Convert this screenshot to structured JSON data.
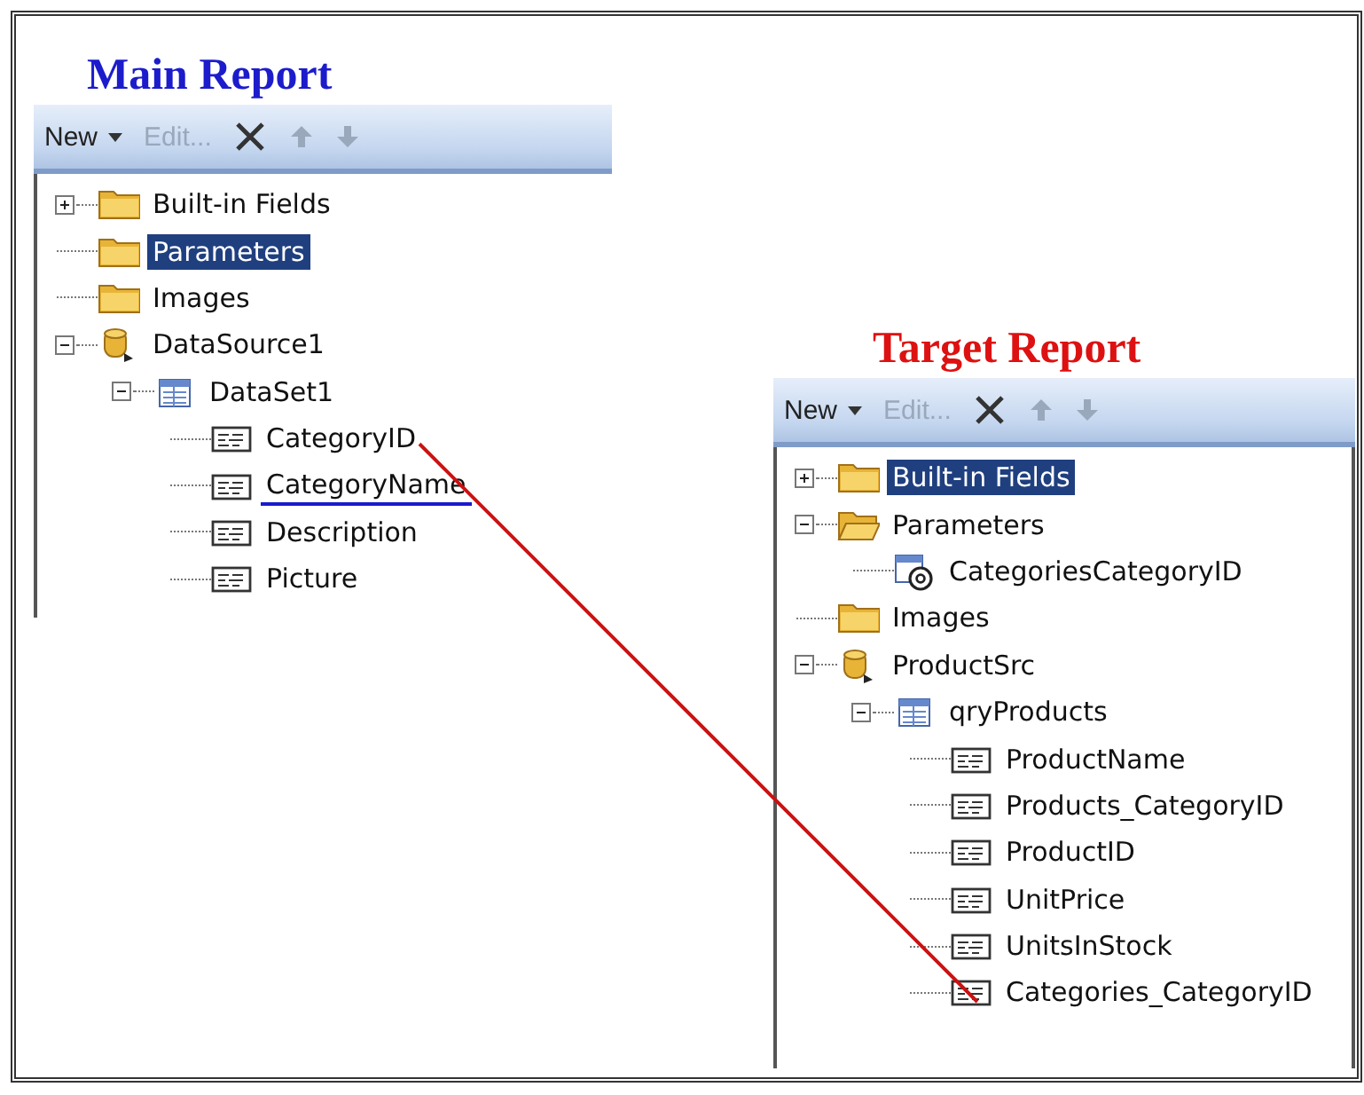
{
  "panels": [
    {
      "title": "Main Report",
      "color": "#1c1ccc",
      "kind": "main",
      "toolbar": [
        {
          "kind": "menu",
          "label": "New",
          "disabled": false
        },
        {
          "kind": "text",
          "label": "Edit...",
          "disabled": true
        },
        {
          "kind": "delete",
          "disabled": false
        },
        {
          "kind": "up",
          "disabled": true
        },
        {
          "kind": "down",
          "disabled": true
        }
      ],
      "tree": [
        {
          "label": "Built-in Fields",
          "kind": "folder",
          "expanded": false,
          "selected": false,
          "underlined": false
        },
        {
          "label": "Parameters",
          "kind": "folder",
          "selected": true,
          "underlined": false
        },
        {
          "label": "Images",
          "kind": "folder",
          "selected": false,
          "underlined": false
        },
        {
          "label": "DataSource1",
          "kind": "datasource",
          "expanded": true,
          "selected": false,
          "underlined": false,
          "children": [
            {
              "label": "DataSet1",
              "kind": "dataset",
              "expanded": true,
              "selected": false,
              "underlined": false,
              "children": [
                {
                  "label": "CategoryID",
                  "kind": "field",
                  "selected": false,
                  "underlined": false,
                  "linked": true
                },
                {
                  "label": "CategoryName",
                  "kind": "field",
                  "selected": false,
                  "underlined": true
                },
                {
                  "label": "Description",
                  "kind": "field",
                  "selected": false,
                  "underlined": false
                },
                {
                  "label": "Picture",
                  "kind": "field",
                  "selected": false,
                  "underlined": false
                }
              ]
            }
          ]
        }
      ]
    },
    {
      "title": "Target Report",
      "color": "#dd1111",
      "kind": "target",
      "toolbar": [
        {
          "kind": "menu",
          "label": "New",
          "disabled": false
        },
        {
          "kind": "text",
          "label": "Edit...",
          "disabled": true
        },
        {
          "kind": "delete",
          "disabled": false
        },
        {
          "kind": "up",
          "disabled": true
        },
        {
          "kind": "down",
          "disabled": true
        }
      ],
      "tree": [
        {
          "label": "Built-in Fields",
          "kind": "folder",
          "expanded": false,
          "selected": true,
          "underlined": false
        },
        {
          "label": "Parameters",
          "kind": "open-folder",
          "expanded": true,
          "selected": false,
          "underlined": false,
          "children": [
            {
              "label": "CategoriesCategoryID",
              "kind": "parameter",
              "selected": false,
              "underlined": false
            }
          ]
        },
        {
          "label": "Images",
          "kind": "folder",
          "selected": false,
          "underlined": false
        },
        {
          "label": "ProductSrc",
          "kind": "datasource",
          "expanded": true,
          "selected": false,
          "underlined": false,
          "children": [
            {
              "label": "qryProducts",
              "kind": "dataset",
              "expanded": true,
              "selected": false,
              "underlined": false,
              "children": [
                {
                  "label": "ProductName",
                  "kind": "field",
                  "selected": false,
                  "underlined": false
                },
                {
                  "label": "Products_CategoryID",
                  "kind": "field",
                  "selected": false,
                  "underlined": false
                },
                {
                  "label": "ProductID",
                  "kind": "field",
                  "selected": false,
                  "underlined": false
                },
                {
                  "label": "UnitPrice",
                  "kind": "field",
                  "selected": false,
                  "underlined": false
                },
                {
                  "label": "UnitsInStock",
                  "kind": "field",
                  "selected": false,
                  "underlined": false
                },
                {
                  "label": "Categories_CategoryID",
                  "kind": "field",
                  "selected": false,
                  "underlined": false,
                  "linked": true
                }
              ]
            }
          ]
        }
      ]
    }
  ],
  "connector": {
    "color": "#cc1111"
  }
}
